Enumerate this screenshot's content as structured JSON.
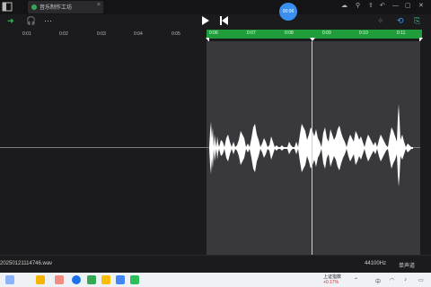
{
  "titlebar": {
    "tab_label": "音乐制作工坊",
    "tab_close": "×",
    "icons": [
      "app-icon",
      "minimize-icon",
      "maximize-icon",
      "close-icon"
    ]
  },
  "toolbar": {
    "record_badge": "00:06",
    "more": "···"
  },
  "ruler": {
    "ticks": [
      "0:01",
      "0:02",
      "0:03",
      "0:04",
      "0:05"
    ],
    "selection_ticks": [
      "0:06",
      "0:07",
      "0:08",
      "0:09",
      "0:10",
      "0:11"
    ]
  },
  "status": {
    "filename": "20250121114746.wav",
    "sample_rate": "44100Hz",
    "channels": "单声道"
  },
  "taskbar": {
    "stock_name": "上证指数",
    "stock_change": "+0.17%"
  },
  "colors": {
    "selection_green": "#1f9d3a",
    "waveform": "#ffffff",
    "background": "#1b1b1d",
    "selection_bg": "#39393d"
  }
}
